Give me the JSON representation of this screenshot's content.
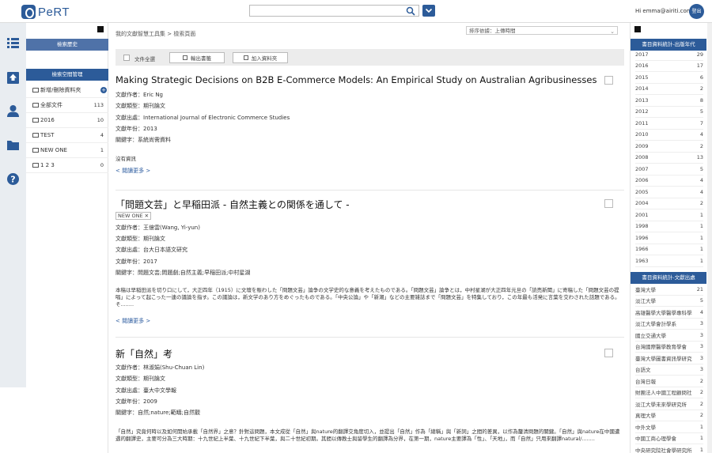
{
  "header": {
    "logo_text": "PeRT",
    "search_placeholder": "",
    "greeting": "Hi emma@airiti.com",
    "logout_label": "登出"
  },
  "left_panel": {
    "history_label": "檢索歷史",
    "folder_manage_label": "檢索空間管理",
    "folders": [
      {
        "label": "新增/刪除資料夾",
        "count": ""
      },
      {
        "label": "全部文件",
        "count": "113"
      },
      {
        "label": "2016",
        "count": "10"
      },
      {
        "label": "TEST",
        "count": "4"
      },
      {
        "label": "NEW ONE",
        "count": "1"
      },
      {
        "label": "1 2 3",
        "count": "0"
      }
    ]
  },
  "main": {
    "breadcrumb": "我的文獻智慧工具集  >  檢索頁面",
    "sort_label": "排序依據：上傳時間",
    "toolbar": {
      "select_all": "文件全選",
      "export_label": "輸出書籤",
      "add_folder_label": "加入資料夾"
    },
    "records": [
      {
        "title": "Making Strategic Decisions on B2B E-Commerce Models: An Empirical Study on Australian Agribusinesses",
        "author": "文獻作者：Eric Ng",
        "type": "文獻類型：期刊論文",
        "source": "文獻出處：International Journal of Electronic Commerce Studies",
        "year": "文獻年份：2013",
        "keywords": "關鍵字：系統尚需資料",
        "abstract": "沒有資訊",
        "more": "< 閱讀更多 >"
      },
      {
        "title": "「問題文芸」と早稲田派 - 自然主義との関係を通して -",
        "tag": "NEW ONE",
        "author": "文獻作者：王億雲(Wang, Yi-yun)",
        "type": "文獻類型：期刊論文",
        "source": "文獻出處：台大日本語文研究",
        "year": "文獻年份：2017",
        "keywords": "關鍵字：問題文芸;問題劇;自然主義;早稲田派;中村星湖",
        "abstract": "本稿は早稲田派を切り口にして，大正四年（1915）に文壇を賑わした「問題文芸」論争の文学史的な意義を考えたものである。「問題文芸」論争とは，中村星湖が大正四年元旦の「読売新聞」に寄稿した「問題文芸の提唱」によって起こった一連の議論を指す。この議論は，新文学のあり方をめぐったものである。「中央公論」や「新潮」などの主要雑誌まで「問題文芸」を特集しており，この年最も活発に言葉を交わされた話題である。そ........",
        "more": "< 閱讀更多 >"
      },
      {
        "title": "新「自然」考",
        "author": "文獻作者：林淑娟(Shu-Chuan Lin)",
        "type": "文獻類型：期刊論文",
        "source": "文獻出處：臺大中文學報",
        "year": "文獻年份：2009",
        "keywords": "關鍵字：自然;nature;範疇;自然觀",
        "abstract": "「自然」究竟何時以及如何開始承載「自然界」之意？針對這問題，本文成從「自然」與nature的翻譯交角度切入，並提出「自然」作為「總稱」與「新詞」之間的差異，以作為釐清問題的關鍵。「自然」與nature在中國遭遇的翻譯史，主要可分為三大時期：十九世紀上半葉、十九世紀下半葉，與二十世紀初期。其間以傳教士與留學生的翻譯為分界，在第一期，nature主要譯為「性」、「天地」，而「自然」只用來翻譯natural/........"
      }
    ]
  },
  "right_panel": {
    "year_head": "書目資料統計-出版年代",
    "years": [
      {
        "k": "2017",
        "v": "29"
      },
      {
        "k": "2016",
        "v": "17"
      },
      {
        "k": "2015",
        "v": "6"
      },
      {
        "k": "2014",
        "v": "2"
      },
      {
        "k": "2013",
        "v": "8"
      },
      {
        "k": "2012",
        "v": "5"
      },
      {
        "k": "2011",
        "v": "7"
      },
      {
        "k": "2010",
        "v": "4"
      },
      {
        "k": "2009",
        "v": "2"
      },
      {
        "k": "2008",
        "v": "13"
      },
      {
        "k": "2007",
        "v": "5"
      },
      {
        "k": "2006",
        "v": "4"
      },
      {
        "k": "2005",
        "v": "4"
      },
      {
        "k": "2004",
        "v": "2"
      },
      {
        "k": "2001",
        "v": "1"
      },
      {
        "k": "1998",
        "v": "1"
      },
      {
        "k": "1996",
        "v": "1"
      },
      {
        "k": "1966",
        "v": "1"
      },
      {
        "k": "1963",
        "v": "1"
      }
    ],
    "source_head": "書目資料統計-文獻出處",
    "sources": [
      {
        "k": "臺灣大學",
        "v": "21"
      },
      {
        "k": "淡江大學",
        "v": "5"
      },
      {
        "k": "高雄醫學大學醫學專科學校",
        "v": "4"
      },
      {
        "k": "淡江大學會計學系",
        "v": "3"
      },
      {
        "k": "國立交通大學",
        "v": "3"
      },
      {
        "k": "台灣國際醫學教育學會",
        "v": "3"
      },
      {
        "k": "臺灣大學圖書資訊學研究所學",
        "v": "3"
      },
      {
        "k": "台語文",
        "v": "3"
      },
      {
        "k": "台灣日報",
        "v": "2"
      },
      {
        "k": "財團法人中國工程顧問社",
        "v": "2"
      },
      {
        "k": "淡江大學未來學研究所",
        "v": "2"
      },
      {
        "k": "真理大學",
        "v": "2"
      },
      {
        "k": "中外文學",
        "v": "1"
      },
      {
        "k": "中國工商心理學會",
        "v": "1"
      },
      {
        "k": "中央研究院社會學研究所",
        "v": "1"
      }
    ]
  }
}
